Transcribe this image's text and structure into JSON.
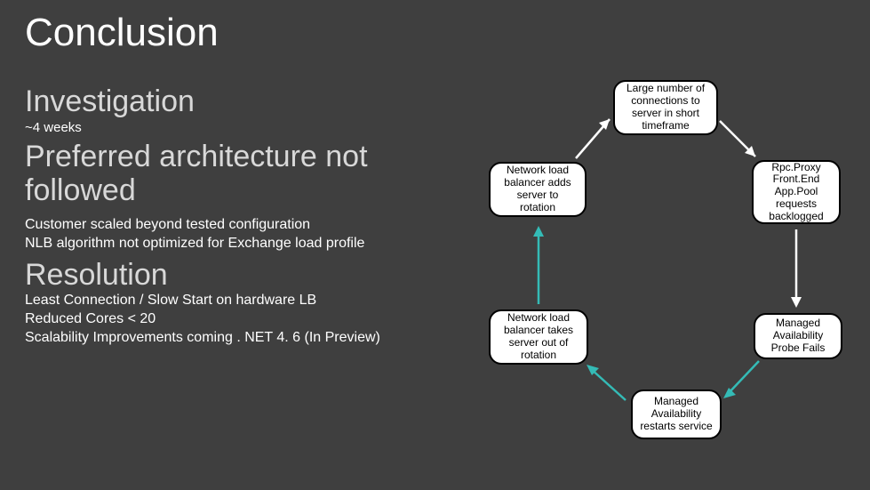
{
  "title": "Conclusion",
  "left": {
    "h1": "Investigation",
    "h1_sub": "~4 weeks",
    "h2": "Preferred architecture not followed",
    "h2_b1": "Customer scaled beyond tested configuration",
    "h2_b2": "NLB algorithm not optimized for Exchange load profile",
    "h3": "Resolution",
    "h3_b1": "Least Connection / Slow Start on hardware LB",
    "h3_b2": "Reduced Cores < 20",
    "h3_b3": "Scalability Improvements coming . NET 4. 6 (In Preview)"
  },
  "diagram": {
    "n_top": "Large number of connections to server in short timeframe",
    "n_tl": "Network load balancer adds server to rotation",
    "n_tr": "Rpc.Proxy Front.End App.Pool requests backlogged",
    "n_bl": "Network load balancer takes server out of rotation",
    "n_br": "Managed Availability Probe Fails",
    "n_bot": "Managed Availability restarts service"
  },
  "colors": {
    "arrow_blue": "#34bbb6",
    "arrow_white": "#ffffff"
  }
}
